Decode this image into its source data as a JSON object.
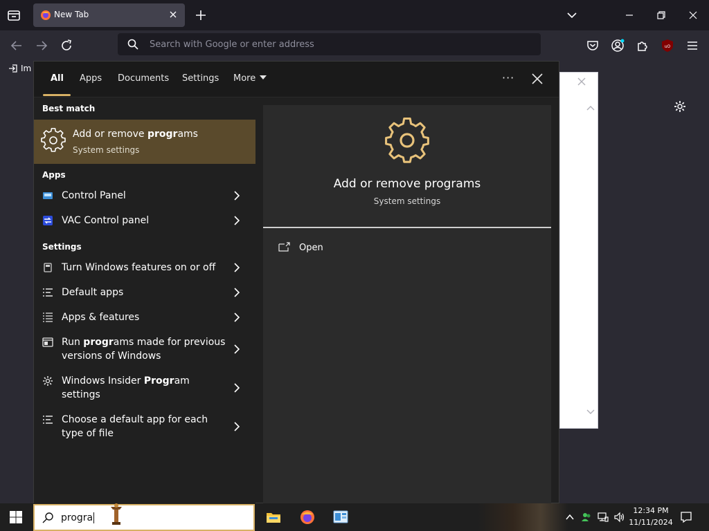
{
  "browser": {
    "tab_title": "New Tab",
    "url_placeholder": "Search with Google or enter address",
    "bookmark_import_label": "Im"
  },
  "search_panel": {
    "tabs": [
      {
        "label": "All",
        "active": true
      },
      {
        "label": "Apps"
      },
      {
        "label": "Documents"
      },
      {
        "label": "Settings"
      },
      {
        "label": "More"
      }
    ],
    "more_label": "···",
    "best_match": {
      "header": "Best match",
      "title_pre": "Add or remove ",
      "title_bold": "progr",
      "title_post": "ams",
      "subtitle": "System settings"
    },
    "apps_header": "Apps",
    "apps": [
      {
        "label": "Control Panel"
      },
      {
        "label": "VAC Control panel"
      }
    ],
    "settings_header": "Settings",
    "settings": [
      {
        "pre": "Turn Windows features on or off",
        "bold": "",
        "post": ""
      },
      {
        "pre": "Default apps",
        "bold": "",
        "post": ""
      },
      {
        "pre": "Apps & features",
        "bold": "",
        "post": ""
      },
      {
        "pre": "Run ",
        "bold": "progr",
        "post": "ams made for previous versions of Windows"
      },
      {
        "pre": "Windows Insider ",
        "bold": "Progr",
        "post": "am settings"
      },
      {
        "pre": "Choose a default app for each type of file",
        "bold": "",
        "post": ""
      }
    ],
    "preview": {
      "title": "Add or remove programs",
      "subtitle": "System settings",
      "open_label": "Open"
    }
  },
  "taskbar": {
    "search_text": "progra",
    "clock_time": "12:34 PM",
    "clock_date": "11/11/2024"
  },
  "colors": {
    "accent": "#d8b165",
    "best_match_bg": "#5a4a2c",
    "panel_bg": "#202020",
    "preview_bg": "#2b2b2b"
  }
}
